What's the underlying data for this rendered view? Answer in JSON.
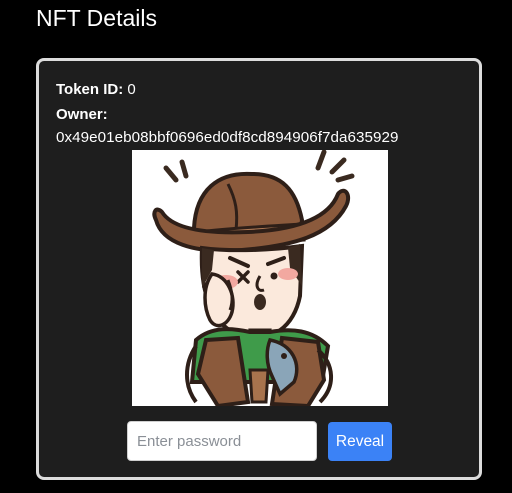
{
  "page": {
    "title": "NFT Details"
  },
  "nft": {
    "token_id_label": "Token ID:",
    "token_id": "0",
    "owner_label": "Owner:",
    "owner_address": "0x49e01eb08bbf0696ed0df8cd894906f7da635929",
    "image_icon": "cowboy-cartoon-image"
  },
  "reveal_form": {
    "password_placeholder": "Enter password",
    "password_value": "",
    "reveal_label": "Reveal",
    "button_color": "#3b82f6"
  }
}
